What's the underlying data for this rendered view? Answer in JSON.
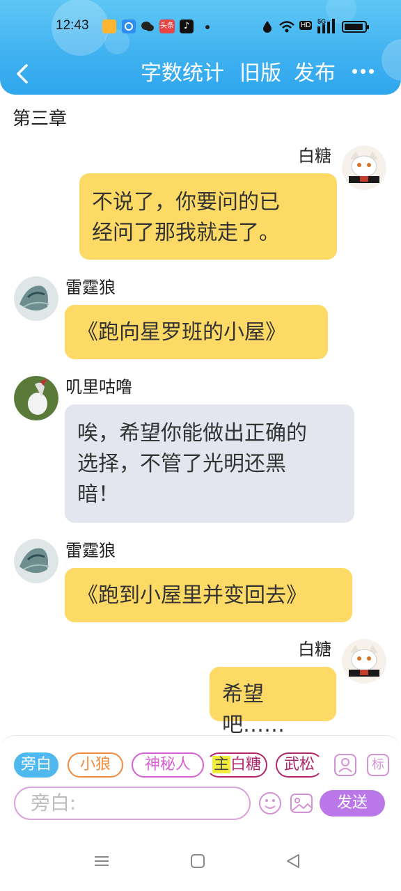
{
  "status_bar": {
    "time": "12:43",
    "app_icons": [
      "reward-app-icon",
      "browser-app-icon",
      "wechat-icon",
      "toutiao-icon",
      "tiktok-icon"
    ],
    "toutiao_label": "头条",
    "right_icons": [
      "water-drop-icon",
      "wifi-icon",
      "hd-icon",
      "5g-signal-icon",
      "battery-icon"
    ],
    "hd_label": "HD",
    "net_label": "5G"
  },
  "header": {
    "back": "back-arrow-icon",
    "word_count": "字数统计",
    "old_version": "旧版",
    "publish": "发布",
    "more": "more-icon",
    "bg_color": "#3fb1f0"
  },
  "chapter_title": "第三章",
  "messages": [
    {
      "speaker": "白糖",
      "side": "right",
      "color": "yellow",
      "text_lines": [
        "不说了，你要问的已",
        "经问了那我就走了。"
      ]
    },
    {
      "speaker": "雷霆狼",
      "side": "left",
      "color": "yellow",
      "text_lines": [
        "《跑向星罗班的小屋》"
      ]
    },
    {
      "speaker": "叽里咕噜",
      "side": "left",
      "color": "gray",
      "text_lines": [
        "唉，希望你能做出正确的",
        "选择，不管了光明还黑",
        "暗！"
      ]
    },
    {
      "speaker": "雷霆狼",
      "side": "left",
      "color": "yellow",
      "text_lines": [
        "《跑到小屋里并变回去》"
      ]
    },
    {
      "speaker": "白糖",
      "side": "right",
      "color": "yellow",
      "text_lines": [
        "希望吧……"
      ]
    }
  ],
  "composer": {
    "chips": [
      {
        "label": "旁白",
        "style": "active"
      },
      {
        "label": "小狼",
        "style": "orange"
      },
      {
        "label": "神秘人",
        "style": "pink"
      },
      {
        "label_prefix": "主",
        "label": "白糖",
        "style": "dark"
      },
      {
        "label": "武松",
        "style": "dark"
      }
    ],
    "tool_icons": [
      "person-icon",
      "tag-icon"
    ],
    "tag_label": "标",
    "placeholder": "旁白:",
    "emoji": "emoji-icon",
    "image": "image-icon",
    "send_label": "发送",
    "send_color": "#b977e8"
  },
  "nav_bar": [
    "menu-icon",
    "home-square-icon",
    "back-triangle-icon"
  ]
}
